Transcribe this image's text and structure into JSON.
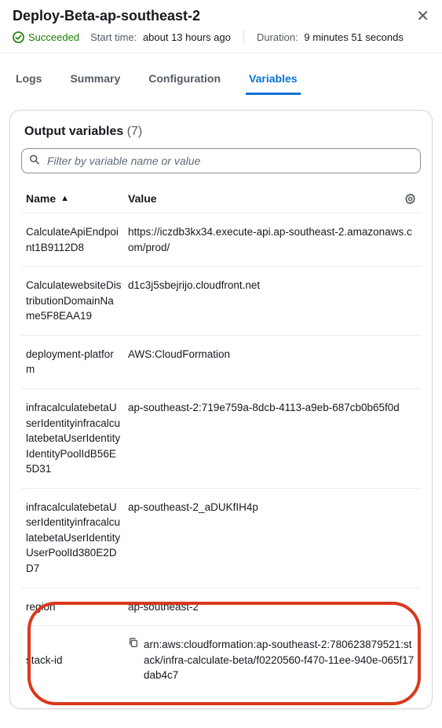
{
  "header": {
    "title": "Deploy-Beta-ap-southeast-2",
    "status_label": "Succeeded",
    "start_label": "Start time:",
    "start_value": "about 13 hours ago",
    "duration_label": "Duration:",
    "duration_value": "9 minutes 51 seconds"
  },
  "tabs": {
    "logs": "Logs",
    "summary": "Summary",
    "configuration": "Configuration",
    "variables": "Variables"
  },
  "panel": {
    "title": "Output variables",
    "count": "(7)",
    "filter_placeholder": "Filter by variable name or value",
    "columns": {
      "name": "Name",
      "value": "Value"
    },
    "rows": [
      {
        "name": "CalculateApiEndpoint1B9112D8",
        "value": "https://iczdb3kx34.execute-api.ap-southeast-2.amazonaws.com/prod/",
        "copy": false
      },
      {
        "name": "CalculatewebsiteDistributionDomainName5F8EAA19",
        "value": "d1c3j5sbejrijo.cloudfront.net",
        "copy": false
      },
      {
        "name": "deployment-platform",
        "value": "AWS:CloudFormation",
        "copy": false
      },
      {
        "name": "infracalculatebetaUserIdentityinfracalculatebetaUserIdentityIdentityPoolIdB56E5D31",
        "value": "ap-southeast-2:719e759a-8dcb-4113-a9eb-687cb0b65f0d",
        "copy": false
      },
      {
        "name": "infracalculatebetaUserIdentityinfracalculatebetaUserIdentityUserPoolId380E2DD7",
        "value": "ap-southeast-2_aDUKfIH4p",
        "copy": false
      },
      {
        "name": "region",
        "value": "ap-southeast-2",
        "copy": false
      },
      {
        "name": "stack-id",
        "value": "arn:aws:cloudformation:ap-southeast-2:780623879521:stack/infra-calculate-beta/f0220560-f470-11ee-940e-065f17dab4c7",
        "copy": true
      }
    ]
  }
}
